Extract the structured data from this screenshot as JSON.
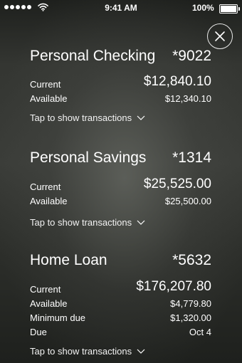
{
  "status_bar": {
    "time": "9:41 AM",
    "battery": "100%",
    "signal_icon": "signal-dots-icon",
    "wifi_icon": "wifi-icon",
    "battery_icon": "battery-full-icon"
  },
  "close_icon": "close-icon",
  "tap_label": "Tap to show transactions",
  "accounts": [
    {
      "name": "Personal Checking",
      "number": "*9022",
      "rows": [
        {
          "label": "Current",
          "value": "$12,840.10"
        },
        {
          "label": "Available",
          "value": "$12,340.10"
        }
      ]
    },
    {
      "name": "Personal Savings",
      "number": "*1314",
      "rows": [
        {
          "label": "Current",
          "value": "$25,525.00"
        },
        {
          "label": "Available",
          "value": "$25,500.00"
        }
      ]
    },
    {
      "name": "Home Loan",
      "number": "*5632",
      "rows": [
        {
          "label": "Current",
          "value": "$176,207.80"
        },
        {
          "label": "Available",
          "value": "$4,779.80"
        },
        {
          "label": "Minimum due",
          "value": "$1,320.00"
        },
        {
          "label": "Due",
          "value": "Oct 4"
        }
      ]
    }
  ]
}
